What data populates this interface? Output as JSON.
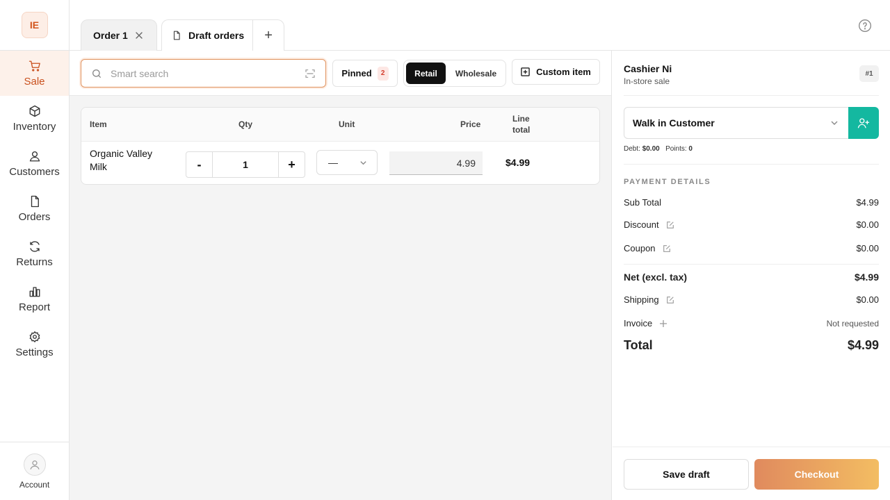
{
  "sidebar": {
    "logo": "IE",
    "items": [
      {
        "label": "Sale",
        "icon": "cart-icon"
      },
      {
        "label": "Inventory",
        "icon": "box-icon"
      },
      {
        "label": "Customers",
        "icon": "user-icon"
      },
      {
        "label": "Orders",
        "icon": "file-icon"
      },
      {
        "label": "Returns",
        "icon": "refresh-icon"
      },
      {
        "label": "Report",
        "icon": "bar-chart-icon"
      },
      {
        "label": "Settings",
        "icon": "gear-icon"
      }
    ],
    "account_label": "Account"
  },
  "tabs": {
    "order_tab": "Order 1",
    "drafts_tab": "Draft orders",
    "add_symbol": "+"
  },
  "toolbar": {
    "search_placeholder": "Smart search",
    "pinned_label": "Pinned",
    "pinned_count": "2",
    "mode_retail": "Retail",
    "mode_wholesale": "Wholesale",
    "custom_item": "Custom item"
  },
  "cart": {
    "headers": {
      "item": "Item",
      "qty": "Qty",
      "unit": "Unit",
      "price": "Price",
      "line_total_1": "Line",
      "line_total_2": "total"
    },
    "rows": [
      {
        "name": "Organic Valley Milk",
        "qty": "1",
        "unit": "—",
        "price": "4.99",
        "line_total": "$4.99"
      }
    ],
    "minus": "-",
    "plus": "+"
  },
  "panel": {
    "cashier": "Cashier Ni",
    "sale_type": "In-store sale",
    "order_no": "#1",
    "customer": "Walk in Customer",
    "debt_label": "Debt:",
    "debt_value": "$0.00",
    "points_label": "Points:",
    "points_value": "0",
    "payment_title": "PAYMENT DETAILS",
    "sub_total_label": "Sub Total",
    "sub_total": "$4.99",
    "discount_label": "Discount",
    "discount": "$0.00",
    "coupon_label": "Coupon",
    "coupon": "$0.00",
    "net_label": "Net (excl. tax)",
    "net": "$4.99",
    "shipping_label": "Shipping",
    "shipping": "$0.00",
    "invoice_label": "Invoice",
    "invoice": "Not requested",
    "total_label": "Total",
    "total": "$4.99",
    "save_draft": "Save draft",
    "checkout": "Checkout"
  },
  "colors": {
    "accent": "#c9501d",
    "teal": "#14b8a0",
    "badge": "#d43c2c"
  }
}
